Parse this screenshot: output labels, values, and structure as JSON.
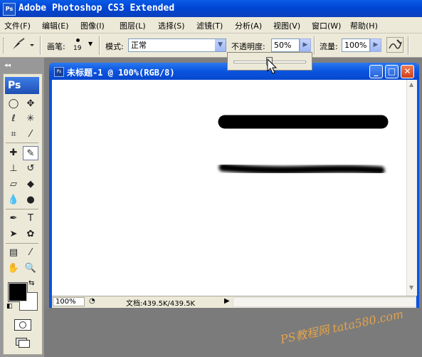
{
  "app": {
    "title": "Adobe Photoshop CS3 Extended",
    "icon_text": "Ps"
  },
  "menu": {
    "items": [
      "文件(F)",
      "编辑(E)",
      "图像(I)",
      "图层(L)",
      "选择(S)",
      "滤镜(T)",
      "分析(A)",
      "视图(V)",
      "窗口(W)",
      "帮助(H)"
    ]
  },
  "options": {
    "brush_label": "画笔:",
    "brush_size": "19",
    "mode_label": "模式:",
    "mode_value": "正常",
    "opacity_label": "不透明度:",
    "opacity_value": "50%",
    "flow_label": "流量:",
    "flow_value": "100%",
    "opacity_slider_fraction": 0.5
  },
  "toolbox": {
    "badge": "Ps",
    "collapse": "◂◂"
  },
  "document": {
    "title": "未标题-1 @ 100%(RGB/8)",
    "zoom": "100%",
    "doc_info": "文档:439.5K/439.5K",
    "btn_minimize": "_",
    "btn_maximize": "□",
    "btn_close": "✕"
  },
  "watermark": "PS教程网 tata580.com",
  "colors": {
    "accent": "#0a53e0",
    "close_button": "#e0471f",
    "watermark": "#e3a34a"
  }
}
